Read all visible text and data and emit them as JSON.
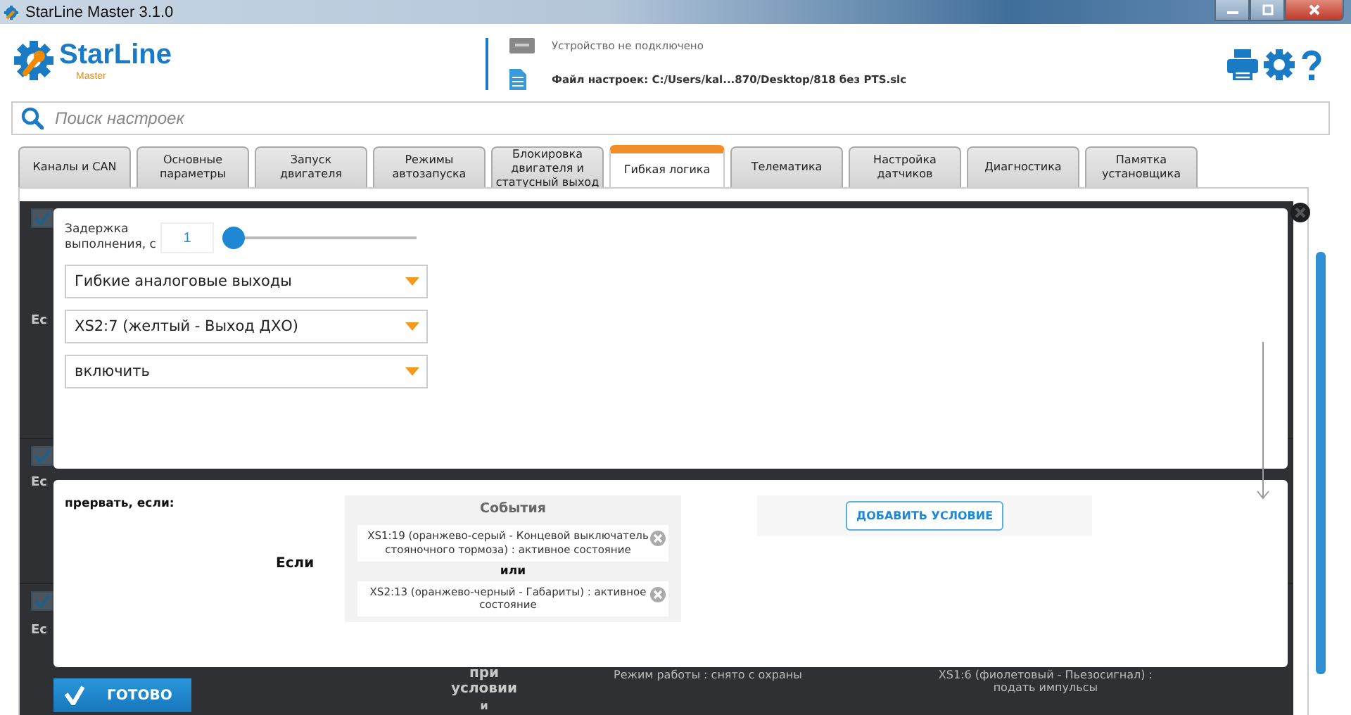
{
  "window": {
    "title": "StarLine Master 3.1.0"
  },
  "header": {
    "logo": "StarLine",
    "logo_sub": "Master",
    "device_status": "Устройство не подключено",
    "settings_file": "Файл настроек: C:/Users/kal...870/Desktop/818 без PTS.slc"
  },
  "search": {
    "placeholder": "Поиск настроек"
  },
  "tabs": [
    {
      "label": "Каналы и CAN",
      "selected": false
    },
    {
      "label": "Основные параметры",
      "selected": false
    },
    {
      "label": "Запуск двигателя",
      "selected": false
    },
    {
      "label": "Режимы автозапуска",
      "selected": false
    },
    {
      "label": "Блокировка двигателя и статусный выход",
      "selected": false
    },
    {
      "label": "Гибкая логика",
      "selected": true
    },
    {
      "label": "Телематика",
      "selected": false
    },
    {
      "label": "Настройка датчиков",
      "selected": false
    },
    {
      "label": "Диагностика",
      "selected": false
    },
    {
      "label": "Памятка установщика",
      "selected": false
    }
  ],
  "background": {
    "rows": [
      {
        "checked": true,
        "label": "Ес"
      },
      {
        "checked": true,
        "label": "Ес"
      },
      {
        "checked": true,
        "label": "Ес"
      }
    ],
    "condition_label": "при условии",
    "and_label": "и",
    "mode": "Режим работы : снято с охраны",
    "action": "XS1:6 (фиолетовый - Пьезосигнал) : подать импульсы"
  },
  "dialog": {
    "delay_label": "Задержка выполнения, с",
    "delay_value": "1",
    "delay_slider": {
      "level": 0
    },
    "dropdowns": [
      "Гибкие аналоговые выходы",
      "XS2:7 (желтый - Выход ДХО)",
      "включить"
    ],
    "abort_label": "прервать, если:",
    "if_label": "Если",
    "events_title": "События",
    "events": [
      "XS1:19 (оранжево-серый - Концевой выключатель стояночного тормоза) : активное состояние",
      "XS2:13 (оранжево-черный - Габариты) : активное состояние"
    ],
    "or_label": "или",
    "add_condition": "ДОБАВИТЬ УСЛОВИЕ",
    "done": "ГОТОВО"
  }
}
